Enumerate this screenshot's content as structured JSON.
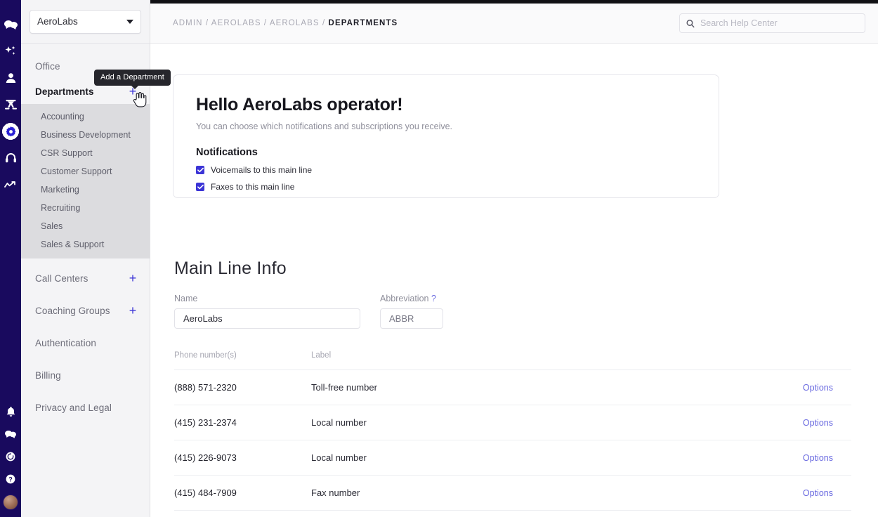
{
  "rail": {
    "top_icons": [
      {
        "name": "logo-chat-icon"
      },
      {
        "name": "sparkles-ai-icon"
      },
      {
        "name": "person-icon"
      },
      {
        "name": "team-group-icon"
      },
      {
        "name": "gear-settings-icon",
        "active": true
      },
      {
        "name": "headset-support-icon"
      },
      {
        "name": "analytics-trend-icon"
      }
    ],
    "bottom_icons": [
      {
        "name": "bell-notifications-icon"
      },
      {
        "name": "chat-messages-icon"
      },
      {
        "name": "refresh-updates-icon"
      },
      {
        "name": "help-question-icon"
      },
      {
        "name": "user-avatar"
      }
    ]
  },
  "sidebar": {
    "org_selector": {
      "value": "AeroLabs",
      "icon": "chevron-down-icon"
    },
    "items": [
      {
        "label": "Office",
        "type": "link"
      },
      {
        "label": "Departments",
        "type": "group",
        "active": true,
        "add": "+"
      },
      {
        "label": "Call Centers",
        "type": "group",
        "add": "+"
      },
      {
        "label": "Coaching Groups",
        "type": "group",
        "add": "+"
      },
      {
        "label": "Authentication",
        "type": "link"
      },
      {
        "label": "Billing",
        "type": "link"
      },
      {
        "label": "Privacy and Legal",
        "type": "link"
      }
    ],
    "departments": [
      "Accounting",
      "Business Development",
      "CSR Support",
      "Customer Support",
      "Marketing",
      "Recruiting",
      "Sales",
      "Sales & Support"
    ],
    "tooltip": "Add a Department"
  },
  "header": {
    "breadcrumb_prefix": "ADMIN / AEROLABS / AEROLABS / ",
    "breadcrumb_current": "DEPARTMENTS",
    "search": {
      "placeholder": "Search Help Center",
      "value": "",
      "icon": "search-icon"
    }
  },
  "hero": {
    "title": "Hello AeroLabs operator!",
    "subtitle": "You can choose which notifications and subscriptions you receive.",
    "section": "Notifications",
    "checkboxes": [
      {
        "label": "Voicemails to this main line",
        "checked": true
      },
      {
        "label": "Faxes to this main line",
        "checked": true
      }
    ]
  },
  "main_line": {
    "title": "Main Line Info",
    "name_label": "Name",
    "name_value": "AeroLabs",
    "abbr_label": "Abbreviation",
    "abbr_help": "?",
    "abbr_value": "ABBR"
  },
  "table": {
    "columns": [
      "Phone number(s)",
      "Label",
      ""
    ],
    "options_label": "Options",
    "rows": [
      {
        "number": "(888) 571-2320",
        "label": "Toll-free number",
        "action": "Options"
      },
      {
        "number": "(415) 231-2374",
        "label": "Local number",
        "action": "Options"
      },
      {
        "number": "(415) 226-9073",
        "label": "Local number",
        "action": "Options"
      },
      {
        "number": "(415) 484-7909",
        "label": "Fax number",
        "action": "Options"
      }
    ]
  },
  "colors": {
    "rail_bg": "#190a5e",
    "accent_blue": "#3b34d6",
    "link_blue": "#6a6ae0",
    "sidebar_bg": "#f4f4f6",
    "submenu_bg": "#dcdcdf"
  }
}
